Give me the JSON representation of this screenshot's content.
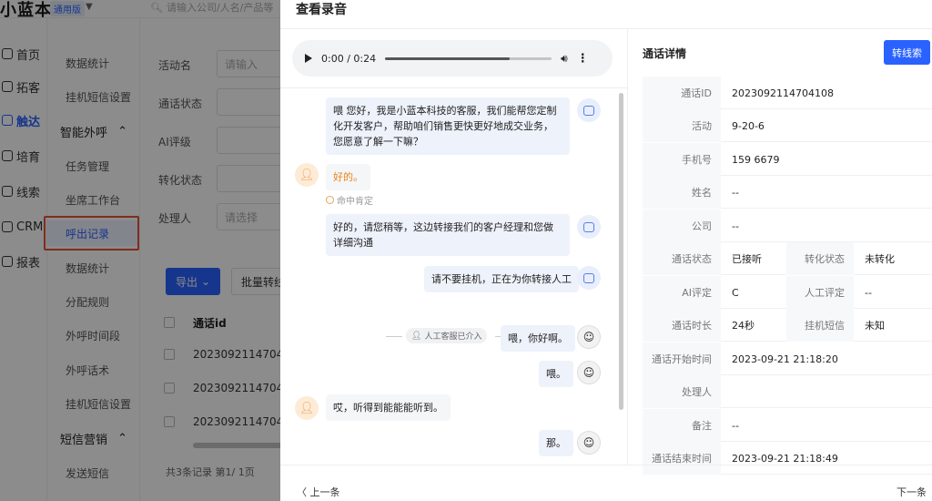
{
  "app": {
    "logo": "小蓝本",
    "version": "通用版",
    "search_placeholder": "请输入公司/人名/产品等"
  },
  "nav_primary": [
    {
      "label": "首页"
    },
    {
      "label": "拓客"
    },
    {
      "label": "触达"
    },
    {
      "label": "培育"
    },
    {
      "label": "线索"
    },
    {
      "label": "CRM"
    },
    {
      "label": "报表"
    }
  ],
  "nav_secondary": {
    "item_data_stats": "数据统计",
    "item_hangup_sms": "挂机短信设置",
    "group_ai_call": "智能外呼",
    "item_task_mgmt": "任务管理",
    "item_agent_desk": "坐席工作台",
    "item_call_records": "呼出记录",
    "item_data_stats2": "数据统计",
    "item_assign_rules": "分配规则",
    "item_call_period": "外呼时间段",
    "item_call_script": "外呼话术",
    "item_hangup_sms2": "挂机短信设置",
    "group_sms": "短信营销",
    "item_send_sms": "发送短信"
  },
  "filters": {
    "activity_label": "活动名",
    "activity_placeholder": "请输入",
    "call_status_label": "通话状态",
    "ai_rating_label": "AI评级",
    "convert_status_label": "转化状态",
    "handler_label": "处理人",
    "handler_placeholder": "请选择"
  },
  "toolbar": {
    "export_label": "导出",
    "batch_label": "批量转线"
  },
  "table": {
    "header": "通话id",
    "rows": [
      "2023092114704",
      "2023092114704",
      "2023092114704"
    ],
    "pager": "共3条记录 第1/ 1页"
  },
  "modal": {
    "title": "查看录音",
    "audio_time": "0:00 / 0:24",
    "audio_progress": 0.75,
    "messages": [
      {
        "role": "bot",
        "text": "喂 您好，我是小蓝本科技的客服，我们能帮您定制化开发客户，帮助咱们销售更快更好地成交业务，您愿意了解一下嘛？"
      },
      {
        "role": "user",
        "text": "好的。",
        "tag": "命中肯定"
      },
      {
        "role": "bot",
        "text": "好的，请您稍等，这边转接我们的客户经理和您做详细沟通"
      },
      {
        "role": "bot",
        "text": "请不要挂机，正在为你转接人工"
      },
      {
        "role": "system",
        "text": "人工客服已介入"
      },
      {
        "role": "agent",
        "text": "喂，你好啊。"
      },
      {
        "role": "agent",
        "text": "喂。"
      },
      {
        "role": "user",
        "text": "哎，听得到能能能听到。"
      },
      {
        "role": "agent",
        "text": "那。"
      }
    ],
    "prev_label": "上一条",
    "next_label": "下一条"
  },
  "details": {
    "title": "通话详情",
    "to_lead_label": "转线索",
    "call_id_label": "通话ID",
    "call_id": "2023092114704108",
    "activity_label": "活动",
    "activity": "9-20-6",
    "phone_label": "手机号",
    "phone": "159 6679",
    "name_label": "姓名",
    "name": "--",
    "company_label": "公司",
    "company": "--",
    "call_status_label": "通话状态",
    "call_status": "已接听",
    "convert_status_label": "转化状态",
    "convert_status": "未转化",
    "ai_rating_label": "AI评定",
    "ai_rating": "C",
    "manual_rating_label": "人工评定",
    "manual_rating": "--",
    "duration_label": "通话时长",
    "duration": "24秒",
    "hangup_sms_label": "挂机短信",
    "hangup_sms": "未知",
    "start_time_label": "通话开始时间",
    "start_time": "2023-09-21 21:18:20",
    "handler_label": "处理人",
    "handler": "",
    "remark_label": "备注",
    "remark": "--",
    "end_time_label": "通话结束时间",
    "end_time": "2023-09-21 21:18:49"
  }
}
